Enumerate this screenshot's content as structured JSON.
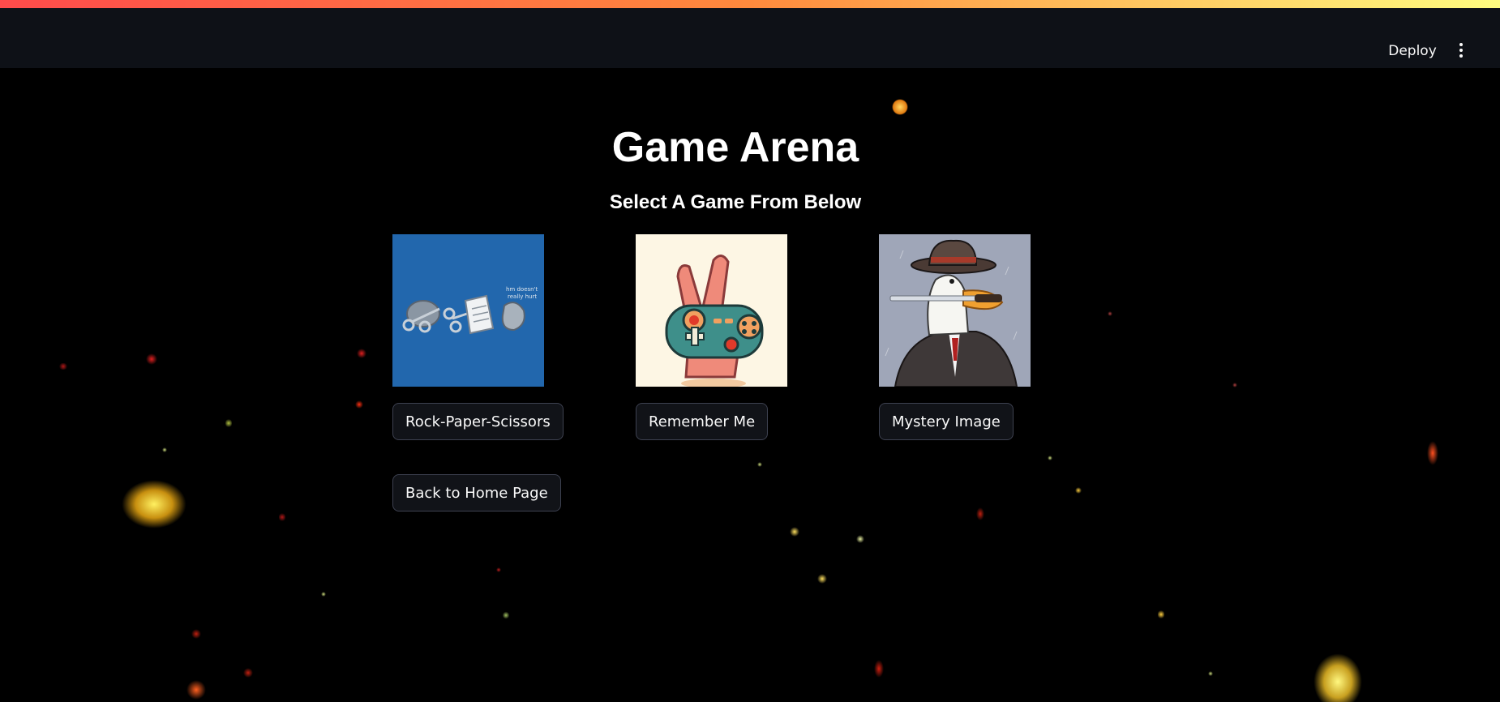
{
  "header": {
    "deploy_label": "Deploy",
    "menu_icon": "vertical-ellipsis-icon",
    "stripe_colors": [
      "#ff4b4b",
      "#ff8a3d",
      "#fffd80"
    ]
  },
  "page": {
    "title": "Game Arena",
    "subtitle": "Select A Game From Below",
    "background_color": "#000000"
  },
  "games": [
    {
      "image": "rock-paper-scissors-image",
      "button_label": "Rock-Paper-Scissors",
      "bg_color": "#2267ad"
    },
    {
      "image": "controller-hand-image",
      "button_label": "Remember Me",
      "bg_color": "#fdf6e4"
    },
    {
      "image": "detective-goose-image",
      "button_label": "Mystery Image",
      "bg_color": "#9fa6b8"
    }
  ],
  "back_button_label": "Back to Home Page"
}
